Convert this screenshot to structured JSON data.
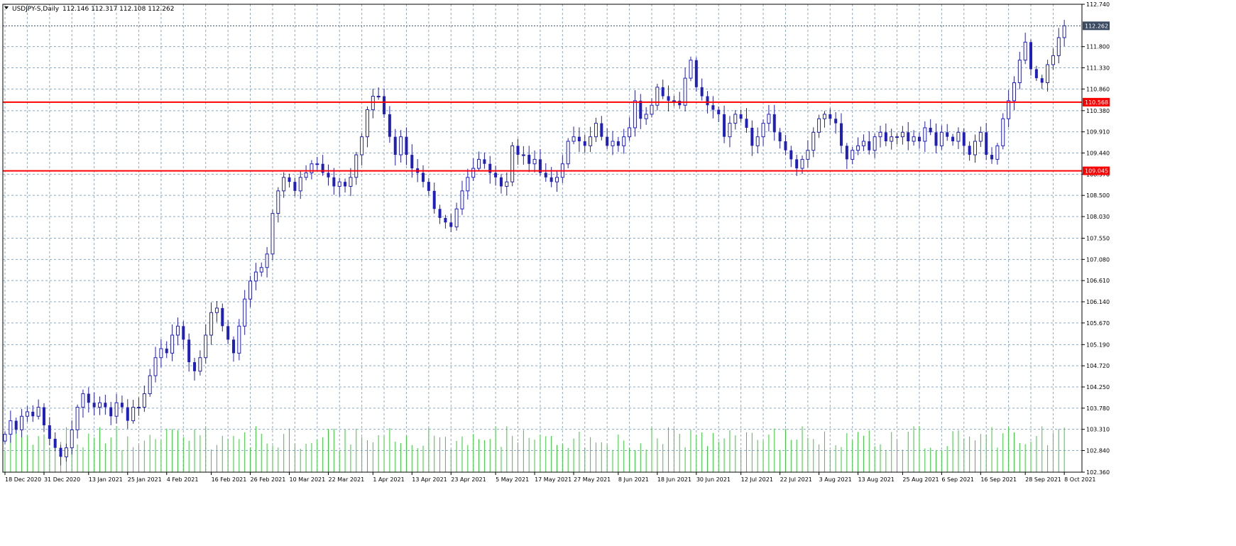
{
  "header": {
    "symbol_label": "USDJPY-S,Daily",
    "ohlc_text": "112.146 112.317 112.108 112.262"
  },
  "colors": {
    "background": "#ffffff",
    "grid": "#8FA8BF",
    "candle": "#1F1FBF",
    "volume": "#33CC33",
    "level_line": "#FF0000",
    "axis": "#000000",
    "price_tag": "#3A4A60"
  },
  "chart_data": {
    "type": "candlestick",
    "symbol": "USDJPY-S",
    "timeframe": "Daily",
    "ylim": [
      102.36,
      112.74
    ],
    "y_ticks": [
      112.74,
      111.8,
      111.33,
      110.86,
      110.38,
      109.91,
      109.44,
      108.97,
      108.5,
      108.03,
      107.55,
      107.08,
      106.61,
      106.14,
      105.67,
      105.19,
      104.72,
      104.25,
      103.78,
      103.31,
      102.84,
      102.36
    ],
    "x_tick_labels": [
      "18 Dec 2020",
      "31 Dec 2020",
      "13 Jan 2021",
      "25 Jan 2021",
      "4 Feb 2021",
      "16 Feb 2021",
      "26 Feb 2021",
      "10 Mar 2021",
      "22 Mar 2021",
      "1 Apr 2021",
      "13 Apr 2021",
      "23 Apr 2021",
      "5 May 2021",
      "17 May 2021",
      "27 May 2021",
      "8 Jun 2021",
      "18 Jun 2021",
      "30 Jun 2021",
      "12 Jul 2021",
      "22 Jul 2021",
      "3 Aug 2021",
      "13 Aug 2021",
      "25 Aug 2021",
      "6 Sep 2021",
      "16 Sep 2021",
      "28 Sep 2021",
      "8 Oct 2021"
    ],
    "horizontal_levels": [
      110.568,
      109.045
    ],
    "current_price": 112.262,
    "price_tags": [
      "112.262",
      "110.568",
      "109.045"
    ],
    "grid": true,
    "closes": [
      103.2,
      103.5,
      103.3,
      103.6,
      103.7,
      103.6,
      103.8,
      103.4,
      103.1,
      102.9,
      102.7,
      102.9,
      103.3,
      103.8,
      104.1,
      103.9,
      103.8,
      103.9,
      103.8,
      103.6,
      103.9,
      103.8,
      103.5,
      103.8,
      103.8,
      104.1,
      104.5,
      104.9,
      105.1,
      105.0,
      105.4,
      105.6,
      105.3,
      104.8,
      104.6,
      104.9,
      105.4,
      105.9,
      106.0,
      105.6,
      105.3,
      105.0,
      105.6,
      106.2,
      106.6,
      106.8,
      106.9,
      107.2,
      108.1,
      108.6,
      108.9,
      108.8,
      108.6,
      108.9,
      109.0,
      109.2,
      109.2,
      109.0,
      108.9,
      108.7,
      108.8,
      108.7,
      108.9,
      109.4,
      109.8,
      110.4,
      110.7,
      110.7,
      110.3,
      109.8,
      109.4,
      109.8,
      109.4,
      109.1,
      109.0,
      108.8,
      108.6,
      108.2,
      108.0,
      107.9,
      107.8,
      108.2,
      108.6,
      108.9,
      109.1,
      109.3,
      109.2,
      109.0,
      108.9,
      108.7,
      108.8,
      109.6,
      109.4,
      109.4,
      109.2,
      109.3,
      109.0,
      108.9,
      108.8,
      108.9,
      109.2,
      109.7,
      109.8,
      109.7,
      109.6,
      109.8,
      110.1,
      109.8,
      109.6,
      109.7,
      109.6,
      109.8,
      110.0,
      110.6,
      110.2,
      110.3,
      110.5,
      110.9,
      110.7,
      110.6,
      110.6,
      110.5,
      111.1,
      111.5,
      110.9,
      110.7,
      110.5,
      110.4,
      110.3,
      109.8,
      110.1,
      110.3,
      110.2,
      110.0,
      109.6,
      109.8,
      110.1,
      110.3,
      109.9,
      109.7,
      109.5,
      109.3,
      109.1,
      109.3,
      109.5,
      109.9,
      110.2,
      110.3,
      110.2,
      110.1,
      109.6,
      109.3,
      109.5,
      109.6,
      109.7,
      109.5,
      109.8,
      109.9,
      109.7,
      109.8,
      109.8,
      109.9,
      109.7,
      109.8,
      109.7,
      110.0,
      109.9,
      109.6,
      109.9,
      109.8,
      109.7,
      109.9,
      109.6,
      109.4,
      109.7,
      109.9,
      109.4,
      109.3,
      109.6,
      110.2,
      110.6,
      111.0,
      111.5,
      111.9,
      111.3,
      111.1,
      111.0,
      111.4,
      111.6,
      112.0,
      112.262
    ]
  }
}
